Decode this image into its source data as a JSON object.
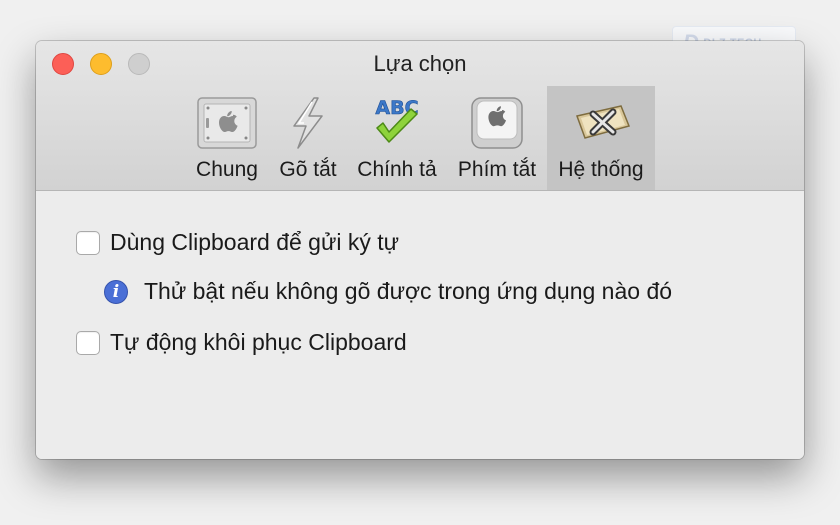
{
  "window": {
    "title": "Lựa chọn",
    "controls": {
      "close_color": "#fc5f57",
      "minimize_color": "#fdbc2e",
      "maximize_color": "#cfcfcf"
    }
  },
  "toolbar": {
    "tabs": [
      {
        "label": "Chung",
        "icon": "general-apple-panel-icon",
        "active": false
      },
      {
        "label": "Gõ tắt",
        "icon": "lightning-bolt-icon",
        "active": false
      },
      {
        "label": "Chính tả",
        "icon": "abc-checkmark-icon",
        "active": false
      },
      {
        "label": "Phím tắt",
        "icon": "apple-key-icon",
        "active": false
      },
      {
        "label": "Hệ thống",
        "icon": "system-x-tools-icon",
        "active": true
      }
    ]
  },
  "options": {
    "clipboard_send": {
      "label": "Dùng Clipboard để gửi ký tự",
      "checked": false
    },
    "clipboard_hint": {
      "icon": "info-icon",
      "text": "Thử bật nếu không gõ được trong ứng dụng nào đó"
    },
    "clipboard_restore": {
      "label": "Tự động khôi phục Clipboard",
      "checked": false
    }
  },
  "colors": {
    "accent_info": "#4a6fd6",
    "active_tab_bg": "#c4c4c4"
  }
}
